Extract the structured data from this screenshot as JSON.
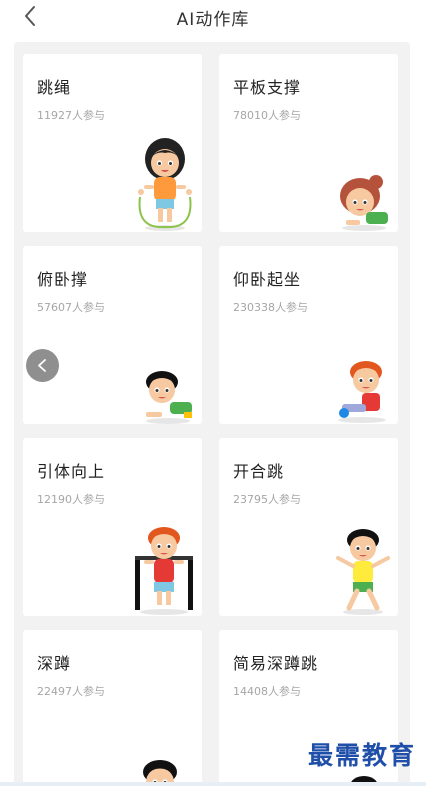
{
  "header": {
    "title": "AI动作库",
    "back_icon": "chevron-left-icon"
  },
  "cards": [
    {
      "name": "跳绳",
      "count": "11927人参与",
      "figure": "jump-rope-girl"
    },
    {
      "name": "平板支撑",
      "count": "78010人参与",
      "figure": "plank-girl"
    },
    {
      "name": "俯卧撑",
      "count": "57607人参与",
      "figure": "pushup-boy"
    },
    {
      "name": "仰卧起坐",
      "count": "230338人参与",
      "figure": "situp-boy"
    },
    {
      "name": "引体向上",
      "count": "12190人参与",
      "figure": "pullup-boy"
    },
    {
      "name": "开合跳",
      "count": "23795人参与",
      "figure": "jumping-jack-boy"
    },
    {
      "name": "深蹲",
      "count": "22497人参与",
      "figure": "squat-boy"
    },
    {
      "name": "简易深蹲跳",
      "count": "14408人参与",
      "figure": "squat-jump-boy"
    }
  ],
  "floating_button": {
    "icon": "chevron-left-icon"
  },
  "watermark": {
    "text": "最需教育"
  },
  "colors": {
    "background": "#f2f2f2",
    "card": "#ffffff",
    "title": "#333333",
    "count": "#a6a6a6",
    "watermark": "#1f4fa8"
  }
}
